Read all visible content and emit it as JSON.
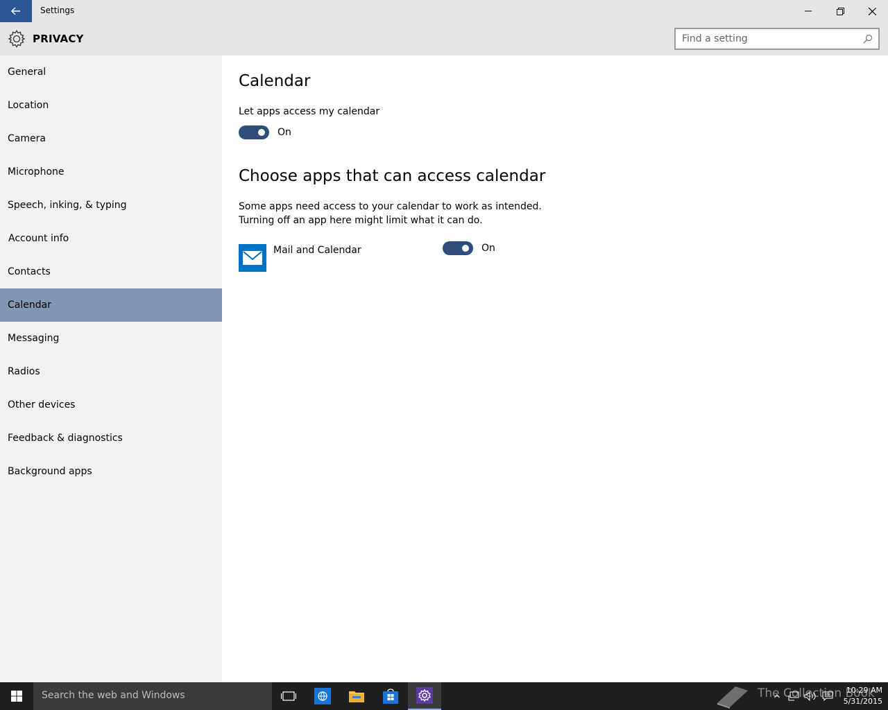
{
  "window": {
    "title": "Settings",
    "back_icon": "back-arrow-icon",
    "minimize_icon": "minimize-icon",
    "restore_icon": "restore-icon",
    "close_icon": "close-icon"
  },
  "header": {
    "icon": "gear-icon",
    "title": "PRIVACY",
    "search_placeholder": "Find a setting",
    "search_icon": "search-icon"
  },
  "sidebar": {
    "items": [
      {
        "label": "General",
        "selected": false
      },
      {
        "label": "Location",
        "selected": false
      },
      {
        "label": "Camera",
        "selected": false
      },
      {
        "label": "Microphone",
        "selected": false
      },
      {
        "label": "Speech, inking, & typing",
        "selected": false
      },
      {
        "label": "Account info",
        "selected": false
      },
      {
        "label": "Contacts",
        "selected": false
      },
      {
        "label": "Calendar",
        "selected": true
      },
      {
        "label": "Messaging",
        "selected": false
      },
      {
        "label": "Radios",
        "selected": false
      },
      {
        "label": "Other devices",
        "selected": false
      },
      {
        "label": "Feedback & diagnostics",
        "selected": false
      },
      {
        "label": "Background apps",
        "selected": false
      }
    ]
  },
  "main": {
    "title": "Calendar",
    "access_label": "Let apps access my calendar",
    "access_toggle": {
      "state": "On",
      "on": true
    },
    "section_title": "Choose apps that can access calendar",
    "description_line1": "Some apps need access to your calendar to work as intended.",
    "description_line2": "Turning off an app here might limit what it can do.",
    "apps": [
      {
        "name": "Mail and Calendar",
        "icon": "mail-icon",
        "toggle": "On",
        "on": true
      }
    ]
  },
  "taskbar": {
    "search_placeholder": "Search the web and Windows",
    "watermark": "The Collection Book",
    "time": "10:29 AM",
    "date": "5/31/2015",
    "accent_color": "#9aa7ff"
  },
  "colors": {
    "accent_back": "#2b5797",
    "selected_nav": "#8197b4",
    "toggle_on": "#2e4d7a",
    "mail_tile": "#0072c6"
  }
}
